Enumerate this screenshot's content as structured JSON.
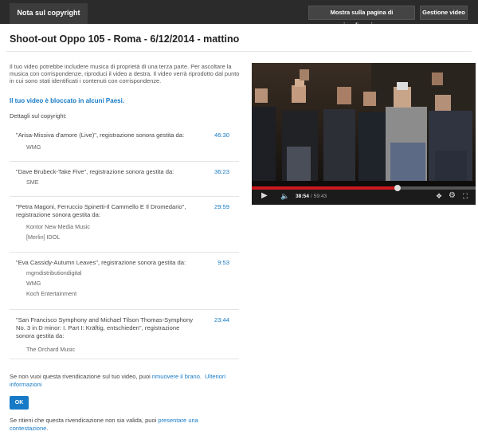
{
  "topbar": {
    "tab_label": "Nota sul copyright",
    "view_page_button": "Mostra sulla pagina di visualizzazione",
    "manage_video_button": "Gestione video"
  },
  "page": {
    "title": "Shoot-out Oppo 105 - Roma - 6/12/2014 - mattino",
    "intro": "Il tuo video potrebbe includere musica di proprietà di una terza parte. Per ascoltare la musica con corrispondenze, riproduci il video a destra. Il video verrà riprodotto dal punto in cui sono stati identificati i contenuti con corrispondenze.",
    "blocked_link": "Il tuo video è bloccato in alcuni Paesi.",
    "details_label": "Dettagli sul copyright:"
  },
  "claims": [
    {
      "title": "\"Arisa-Missiva d'amore (Live)\", registrazione sonora gestita da:",
      "time": "46:30",
      "owners": [
        "WMG"
      ]
    },
    {
      "title": "\"Dave Brubeck-Take Five\", registrazione sonora gestita da:",
      "time": "36:23",
      "owners": [
        "SME"
      ]
    },
    {
      "title": "\"Petra Magoni, Ferruccio Spinetti-Il Cammello E Il Dromedario\", registrazione sonora gestita da:",
      "time": "29:59",
      "owners": [
        "Kontor New Media Music",
        "[Merlin] IDOL"
      ]
    },
    {
      "title": "\"Eva Cassidy-Autumn Leaves\", registrazione sonora gestita da:",
      "time": "9:53",
      "owners": [
        "mgmdistributiondigital",
        "WMG",
        "Koch Entertainment"
      ]
    },
    {
      "title": "\"San Francisco Symphony and Michael Tilson Thomas-Symphony No. 3 in D minor: I. Part I: Kräftig, entschieden\", registrazione sonora gestita da:",
      "time": "23:44",
      "owners": [
        "The Orchard Music"
      ]
    }
  ],
  "footer": {
    "remove_prefix": "Se non vuoi questa rivendicazione sul tuo video, puoi ",
    "remove_link": "rimuovere il brano.",
    "more_info_link": "Ulteriori informazioni",
    "ok_button": "OK",
    "dispute_prefix": "Se ritieni che questa rivendicazione non sia valida, puoi ",
    "dispute_link": "presentare una contestazione",
    "dispute_suffix": "."
  },
  "player": {
    "current_time": "38:54",
    "duration": "/ 59:43",
    "progress_fraction": 0.651,
    "icons": [
      "play-icon",
      "volume-mute-icon",
      "annotations-icon",
      "settings-gear-icon",
      "fullscreen-icon"
    ]
  },
  "colors": {
    "accent": "#167ac6",
    "topbar": "#2b2b2b",
    "progress": "#cc181e"
  }
}
